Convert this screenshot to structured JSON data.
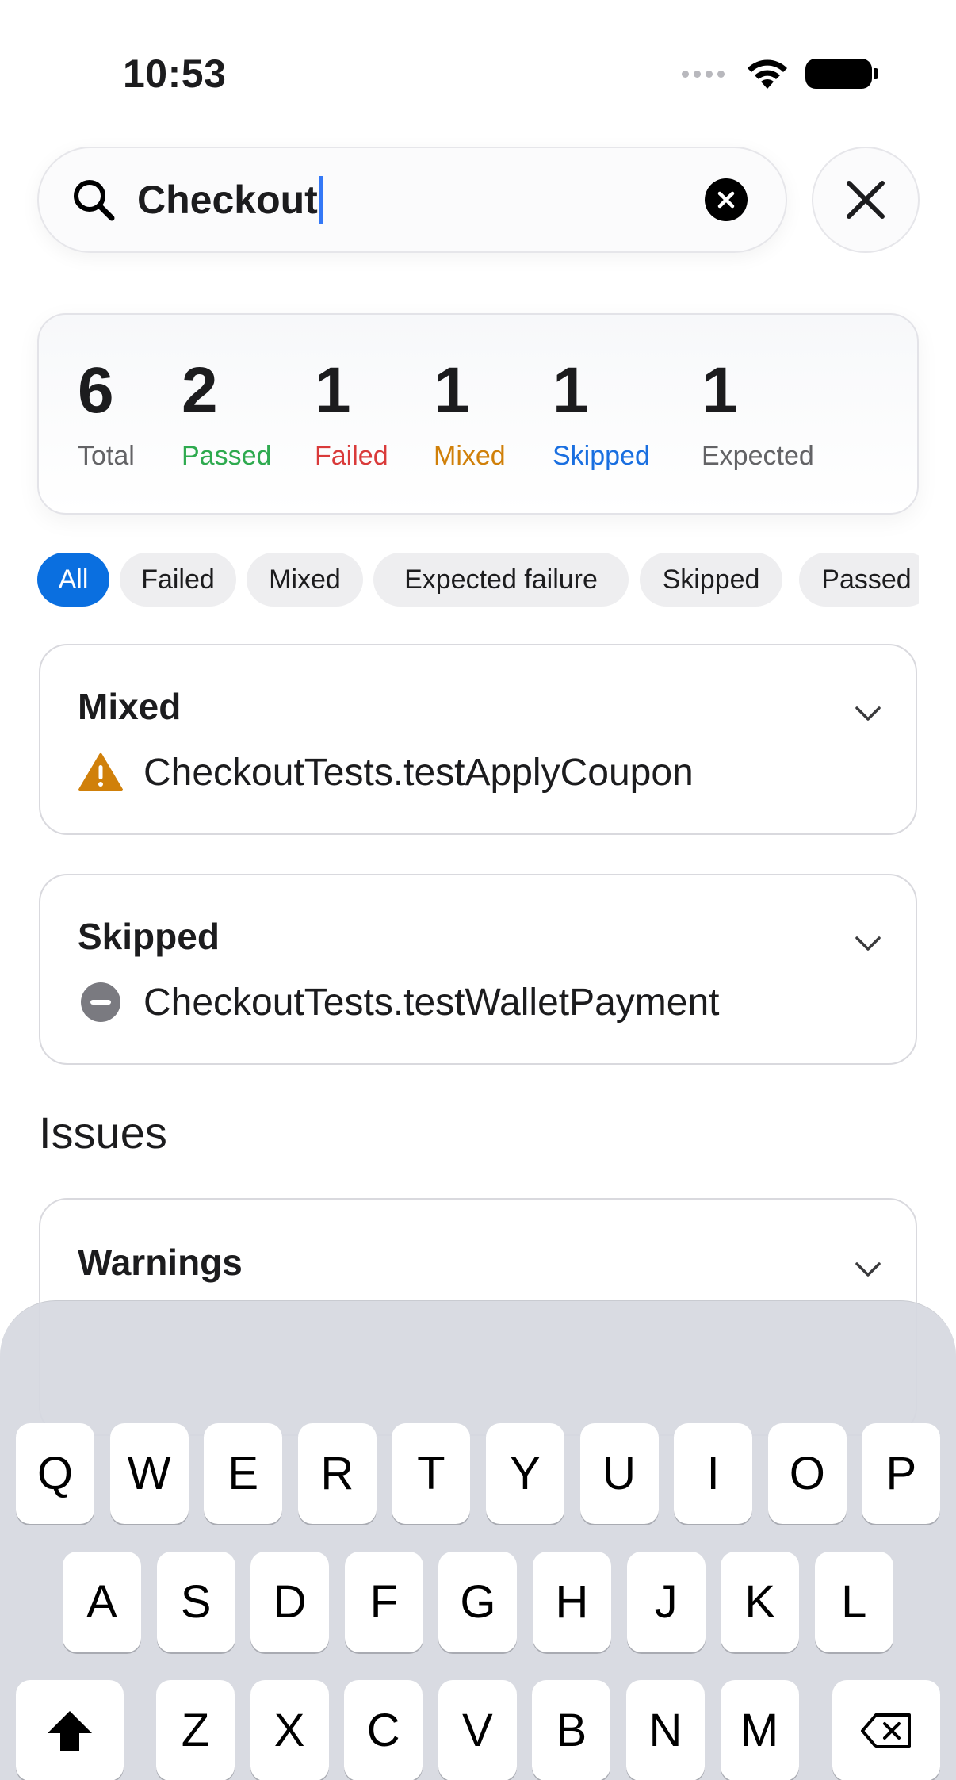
{
  "status_bar": {
    "time": "10:53"
  },
  "search": {
    "value": "Checkout"
  },
  "summary": {
    "stats": [
      {
        "value": "6",
        "label": "Total",
        "color": "#636366"
      },
      {
        "value": "2",
        "label": "Passed",
        "color": "#2eaa4f"
      },
      {
        "value": "1",
        "label": "Failed",
        "color": "#d93a3a"
      },
      {
        "value": "1",
        "label": "Mixed",
        "color": "#d0800a"
      },
      {
        "value": "1",
        "label": "Skipped",
        "color": "#1a6fe0"
      },
      {
        "value": "1",
        "label": "Expected",
        "color": "#636366"
      }
    ]
  },
  "filters": {
    "active": "All",
    "chips": [
      "All",
      "Failed",
      "Mixed",
      "Expected failure",
      "Skipped",
      "Passed"
    ]
  },
  "results": [
    {
      "title": "Mixed",
      "icon": "warning-icon",
      "test": "CheckoutTests.testApplyCoupon"
    },
    {
      "title": "Skipped",
      "icon": "skipped-icon",
      "test": "CheckoutTests.testWalletPayment"
    }
  ],
  "issues": {
    "heading": "Issues",
    "sections": [
      {
        "title": "Warnings"
      }
    ]
  },
  "keyboard": {
    "row1": [
      "Q",
      "W",
      "E",
      "R",
      "T",
      "Y",
      "U",
      "I",
      "O",
      "P"
    ],
    "row2": [
      "A",
      "S",
      "D",
      "F",
      "G",
      "H",
      "J",
      "K",
      "L"
    ],
    "row3": [
      "Z",
      "X",
      "C",
      "V",
      "B",
      "N",
      "M"
    ]
  },
  "colors": {
    "accent": "#0a6fe0",
    "warning": "#d0800a",
    "skipped": "#7a7a80"
  }
}
